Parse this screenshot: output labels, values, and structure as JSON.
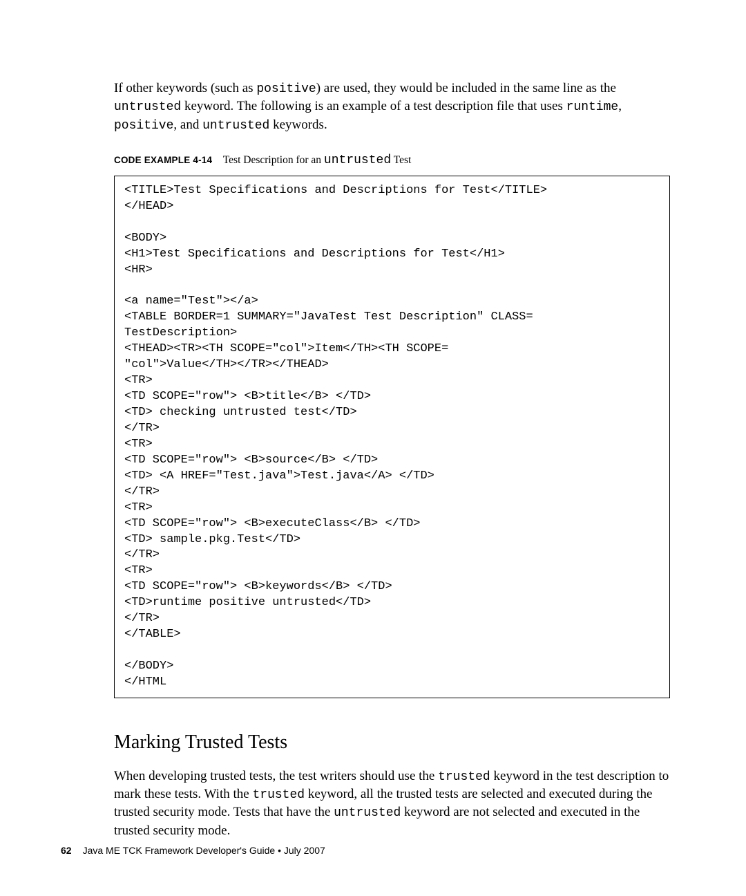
{
  "intro": {
    "p1_part1": "If other keywords (such as ",
    "p1_code1": "positive",
    "p1_part2": ") are used, they would be included in the same line as the ",
    "p1_code2": "untrusted",
    "p1_part3": " keyword. The following is an example of a test description file that uses ",
    "p1_code3": "runtime",
    "p1_comma1": ", ",
    "p1_code4": "positive",
    "p1_comma2": ", and ",
    "p1_code5": "untrusted",
    "p1_part4": " keywords."
  },
  "caption": {
    "label": "CODE EXAMPLE 4-14",
    "text_part1": "Test Description for an ",
    "text_mono": "untrusted",
    "text_part2": " Test"
  },
  "code": "<TITLE>Test Specifications and Descriptions for Test</TITLE>\n</HEAD>\n\n<BODY>\n<H1>Test Specifications and Descriptions for Test</H1>\n<HR>\n\n<a name=\"Test\"></a>\n<TABLE BORDER=1 SUMMARY=\"JavaTest Test Description\" CLASS=\nTestDescription>\n<THEAD><TR><TH SCOPE=\"col\">Item</TH><TH SCOPE=\n\"col\">Value</TH></TR></THEAD>\n<TR>\n<TD SCOPE=\"row\"> <B>title</B> </TD>\n<TD> checking untrusted test</TD>\n</TR>\n<TR>\n<TD SCOPE=\"row\"> <B>source</B> </TD>\n<TD> <A HREF=\"Test.java\">Test.java</A> </TD>\n</TR>\n<TR>\n<TD SCOPE=\"row\"> <B>executeClass</B> </TD>\n<TD> sample.pkg.Test</TD>\n</TR>\n<TR>\n<TD SCOPE=\"row\"> <B>keywords</B> </TD>\n<TD>runtime positive untrusted</TD>\n</TR>\n</TABLE>\n\n</BODY>\n</HTML",
  "section": {
    "heading": "Marking Trusted Tests",
    "p1_part1": "When developing trusted tests, the test writers should use the ",
    "p1_code1": "trusted",
    "p1_part2": " keyword in the test description to mark these tests. With the ",
    "p1_code2": "trusted",
    "p1_part3": " keyword, all the trusted tests are selected and executed during the trusted security mode. Tests that have the ",
    "p1_code3": "untrusted",
    "p1_part4": " keyword are not selected and executed in the trusted security mode."
  },
  "footer": {
    "page": "62",
    "text": "Java ME TCK Framework Developer's Guide  •  July 2007"
  }
}
